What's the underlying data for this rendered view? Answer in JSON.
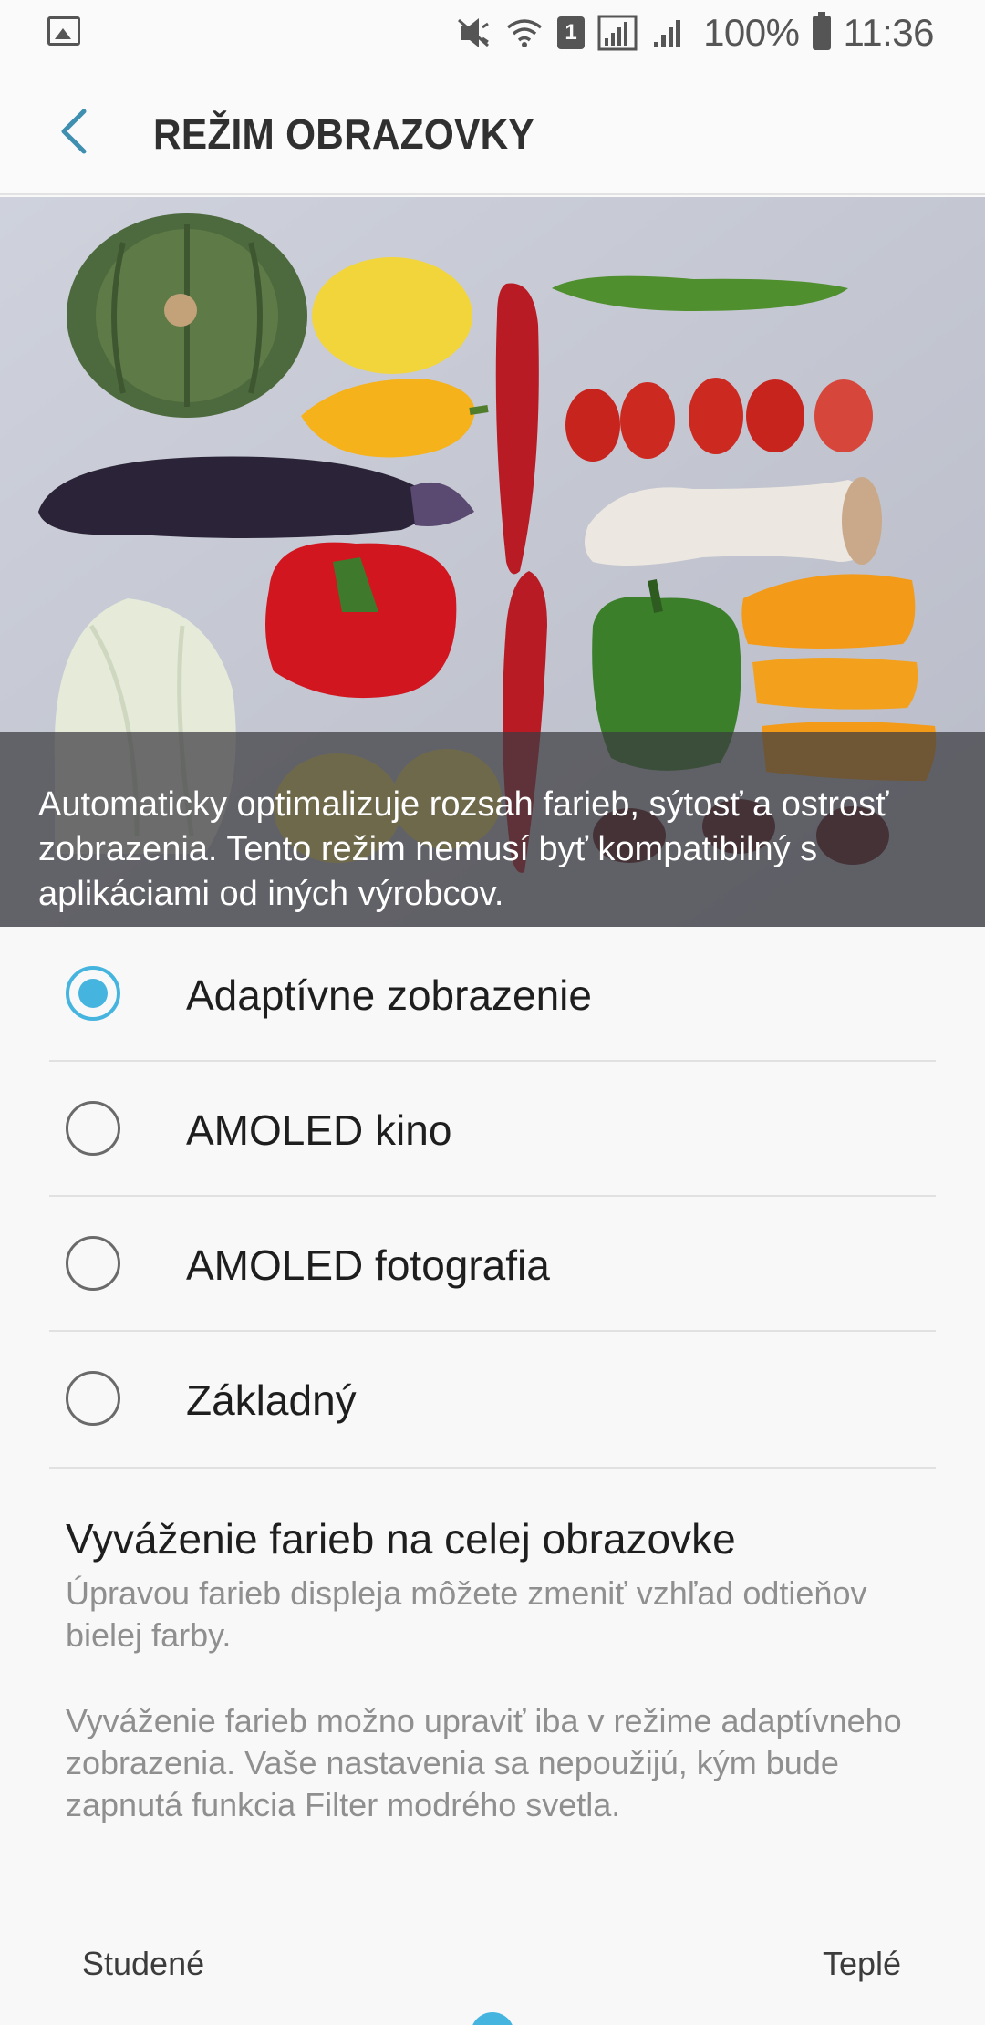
{
  "status_bar": {
    "icons": [
      "gallery-icon",
      "mute-icon",
      "wifi-icon",
      "sim-icon",
      "signal-icon",
      "battery-icon"
    ],
    "sim_slot": "1",
    "battery": "100%",
    "time": "11:36"
  },
  "header": {
    "title": "REŽIM OBRAZOVKY",
    "back_icon": "chevron-left-icon"
  },
  "preview": {
    "caption": "Automaticky optimalizuje rozsah farieb, sýtosť a ostrosť zobrazenia. Tento režim nemusí byť kompatibilný s aplikáciami od iných výrobcov."
  },
  "options": [
    {
      "label": "Adaptívne zobrazenie",
      "checked": true
    },
    {
      "label": "AMOLED kino",
      "checked": false
    },
    {
      "label": "AMOLED fotografia",
      "checked": false
    },
    {
      "label": "Základný",
      "checked": false
    }
  ],
  "color_balance": {
    "title": "Vyváženie farieb na celej obrazovke",
    "description": "Úpravou farieb displeja môžete zmeniť vzhľad odtieňov bielej farby.",
    "note": "Vyváženie farieb možno upraviť iba v režime adaptívneho zobrazenia. Vaše nastavenia sa nepoužijú, kým bude zapnutá funkcia Filter modrého svetla.",
    "cool_label": "Studené",
    "warm_label": "Teplé"
  },
  "colors": {
    "accent": "#45b5e0",
    "secondary_text": "#8f8f8f"
  }
}
